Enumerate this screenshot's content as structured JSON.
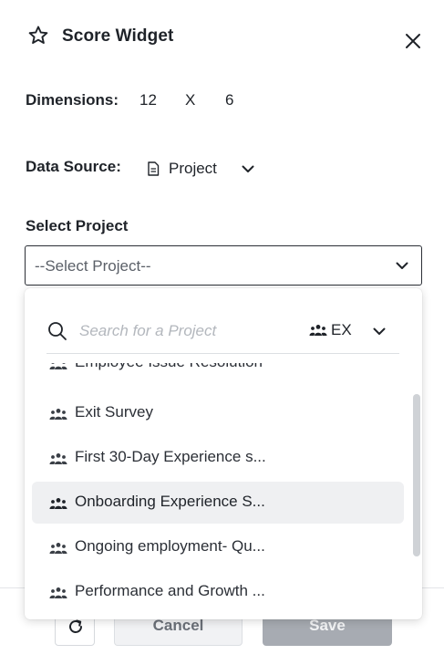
{
  "header": {
    "title": "Score Widget",
    "title_icon": "star-outline-icon",
    "close_icon": "close-icon"
  },
  "dimensions": {
    "label": "Dimensions:",
    "width": "12",
    "separator": "X",
    "height": "6"
  },
  "data_source": {
    "label": "Data Source:",
    "icon": "document-icon",
    "value": "Project",
    "chevron_icon": "chevron-down-icon"
  },
  "select_project": {
    "label": "Select Project",
    "placeholder": "--Select Project--",
    "chevron_icon": "chevron-down-icon"
  },
  "dropdown": {
    "search_placeholder": "Search for a Project",
    "search_value": "",
    "filter": {
      "icon": "group-icon",
      "label": "EX"
    },
    "items": [
      {
        "label": "Employee Issue Resolution",
        "selected": false
      },
      {
        "label": "Exit Survey",
        "selected": false
      },
      {
        "label": "First 30-Day Experience s...",
        "selected": false
      },
      {
        "label": "Onboarding Experience S...",
        "selected": true
      },
      {
        "label": "Ongoing employment- Qu...",
        "selected": false
      },
      {
        "label": "Performance and Growth ...",
        "selected": false
      }
    ]
  },
  "footer": {
    "refresh_icon": "refresh-icon",
    "cancel_label": "Cancel",
    "save_label": "Save"
  }
}
